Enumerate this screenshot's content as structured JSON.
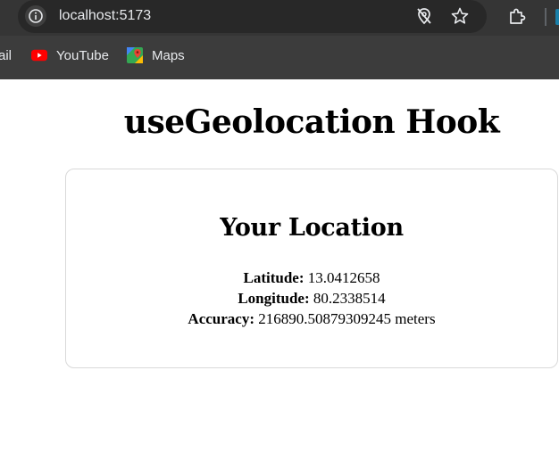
{
  "browser": {
    "url": "localhost:5173",
    "bookmarks": [
      {
        "label": "ail",
        "icon": "gmail-icon"
      },
      {
        "label": "YouTube",
        "icon": "youtube-icon"
      },
      {
        "label": "Maps",
        "icon": "maps-icon"
      }
    ],
    "icons": {
      "site_info": "info-icon",
      "location_blocked": "location-off-icon",
      "bookmark_star": "star-icon",
      "extensions": "puzzle-icon"
    },
    "colors": {
      "chrome_bg": "#3c3c3c",
      "omnibox_bg": "#282828",
      "youtube_red": "#ff0000"
    }
  },
  "page": {
    "title": "useGeolocation Hook",
    "card": {
      "heading": "Your Location",
      "latitude_label": "Latitude:",
      "latitude_value": "13.0412658",
      "longitude_label": "Longitude:",
      "longitude_value": "80.2338514",
      "accuracy_label": "Accuracy:",
      "accuracy_value": "216890.50879309245 meters"
    }
  }
}
